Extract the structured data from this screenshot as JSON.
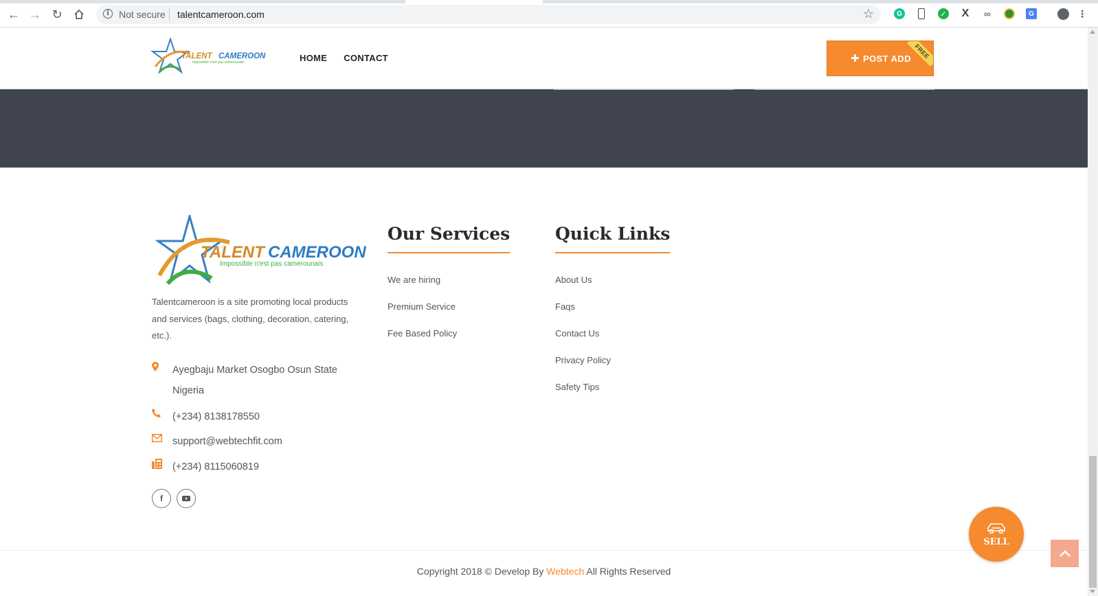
{
  "browser": {
    "security_label": "Not secure",
    "url": "talentcameroon.com"
  },
  "header": {
    "logo_text": "TALENT CAMEROON",
    "logo_tagline": "Impossible n'est pas camerounais",
    "menu": [
      {
        "label": "HOME"
      },
      {
        "label": "CONTACT"
      }
    ],
    "post_add_label": "POST ADD",
    "post_add_ribbon": "FREE"
  },
  "footer": {
    "logo_text_left": "TALENT",
    "logo_text_right": "CAMEROON",
    "logo_tagline": "Impossible n'est pas camerounais",
    "about": "Talentcameroon is a site promoting local products and services (bags, clothing, decoration, catering, etc.).",
    "address": "Ayegbaju Market Osogbo Osun State Nigeria",
    "phone": "(+234) 8138178550",
    "email": "support@webtechfit.com",
    "fax": "(+234) 8115060819",
    "services": {
      "title": "Our Services",
      "items": [
        "We are hiring",
        "Premium Service",
        "Fee Based Policy"
      ]
    },
    "quick_links": {
      "title": "Quick Links",
      "items": [
        "About Us",
        "Faqs",
        "Contact Us",
        "Privacy Policy",
        "Safety Tips"
      ]
    },
    "copyright_prefix": "Copyright 2018 © Develop By",
    "copyright_brand": "Webtech",
    "copyright_suffix": "All Rights Reserved"
  },
  "sell_label": "SELL",
  "colors": {
    "accent": "#f58a2e",
    "dark_band": "#40444f"
  }
}
